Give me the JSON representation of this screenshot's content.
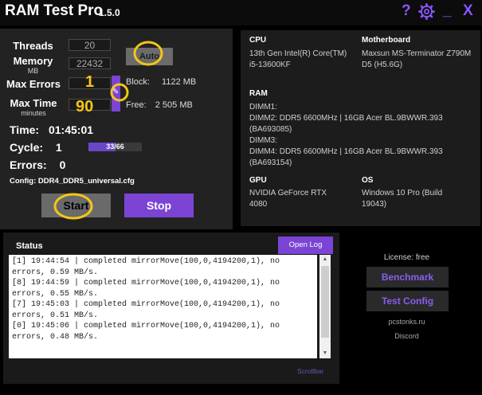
{
  "app": {
    "title": "RAM Test Pro",
    "version": "1.5.0"
  },
  "titlebar": {
    "help": "?",
    "settings_icon": "gear-icon",
    "minimize": "_",
    "close": "X"
  },
  "settings": {
    "threads_label": "Threads",
    "threads_value": "20",
    "memory_label": "Memory",
    "memory_unit": "MB",
    "memory_value": "22432",
    "auto_label": "Auto",
    "max_errors_label": "Max Errors",
    "max_errors_value": "",
    "max_time_label": "Max Time",
    "max_time_unit": "minutes",
    "max_time_value": "",
    "block_label": "Block:",
    "block_value": "1122 MB",
    "free_label": "Free:",
    "free_value": "2 505 MB"
  },
  "annotations": {
    "max_errors": "1",
    "max_time": "90"
  },
  "run": {
    "time_label": "Time:",
    "time_value": "01:45:01",
    "cycle_label": "Cycle:",
    "cycle_value": "1",
    "progress_text": "33/66",
    "progress_fraction": 0.5,
    "errors_label": "Errors:",
    "errors_value": "0",
    "config_label": "Config:",
    "config_value": "DDR4_DDR5_universal.cfg"
  },
  "buttons": {
    "start": "Start",
    "stop": "Stop"
  },
  "system": {
    "cpu_label": "CPU",
    "cpu_value": "13th Gen Intel(R) Core(TM) i5-13600KF",
    "motherboard_label": "Motherboard",
    "motherboard_value": "Maxsun MS-Terminator Z790M D5 (H5.6G)",
    "ram_label": "RAM",
    "dimm1": "DIMM1:",
    "dimm2": "DIMM2: DDR5 6600MHz | 16GB Acer BL.9BWWR.393 (BA693085)",
    "dimm3": "DIMM3:",
    "dimm4": "DIMM4: DDR5 6600MHz | 16GB Acer BL.9BWWR.393 (BA693154)",
    "gpu_label": "GPU",
    "gpu_value": "NVIDIA GeForce RTX 4080",
    "os_label": "OS",
    "os_value": "Windows 10 Pro (Build 19043)"
  },
  "status": {
    "title": "Status",
    "open_log": "Open Log",
    "scrollbar_label": "Scrollbar",
    "log_lines": [
      "[1] 19:44:54 | completed mirrorMove(100,0,4194200,1), no",
      "errors, 0.59 MB/s.",
      "[8] 19:44:59 | completed mirrorMove(100,0,4194200,1), no",
      "errors, 0.55 MB/s.",
      "[7] 19:45:03 | completed mirrorMove(100,0,4194200,1), no",
      "errors, 0.51 MB/s.",
      "[0] 19:45:06 | completed mirrorMove(100,0,4194200,1), no",
      "errors, 0.48 MB/s."
    ]
  },
  "sidebar": {
    "license": "License: free",
    "benchmark": "Benchmark",
    "test_config": "Test Config",
    "site": "pcstonks.ru",
    "discord": "Discord"
  },
  "colors": {
    "accent": "#7b44d4",
    "annotation": "#f5c518"
  }
}
